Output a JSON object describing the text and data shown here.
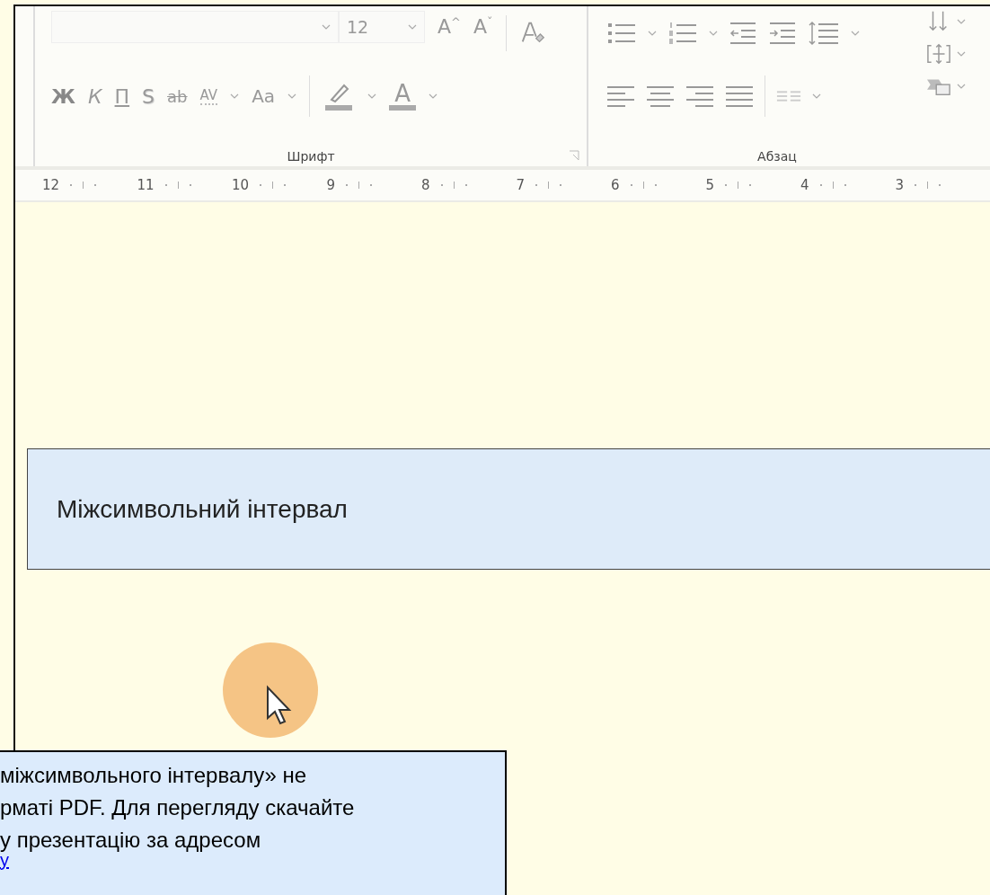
{
  "ribbon": {
    "font_group": {
      "label": "Шрифт",
      "font_size": {
        "value": "12"
      },
      "size_buttons": [
        {
          "label": "A",
          "mark": "^"
        },
        {
          "label": "A",
          "mark": "ˇ"
        }
      ],
      "format_buttons": [
        {
          "label": "Ж",
          "kind": "bold"
        },
        {
          "label": "К",
          "kind": "italic"
        },
        {
          "label": "П",
          "kind": "underline"
        },
        {
          "label": "S",
          "kind": "shadow"
        },
        {
          "label": "ab",
          "kind": "strike"
        },
        {
          "label": "AV",
          "kind": "spacing"
        },
        {
          "label": "Aa",
          "kind": "case"
        }
      ],
      "font_color_label": "A"
    },
    "paragraph_group": {
      "label": "Абзац"
    }
  },
  "ruler": [
    "12",
    "11",
    "10",
    "9",
    "8",
    "7",
    "6",
    "5",
    "4",
    "3"
  ],
  "slide": {
    "heading": "Міжсимвольний інтервал"
  },
  "note": {
    "lines": [
      "міжсимвольного інтервалу» не",
      "рматі PDF. Для перегляду скачайте",
      "у презентацію за адресом"
    ],
    "link": "у"
  }
}
